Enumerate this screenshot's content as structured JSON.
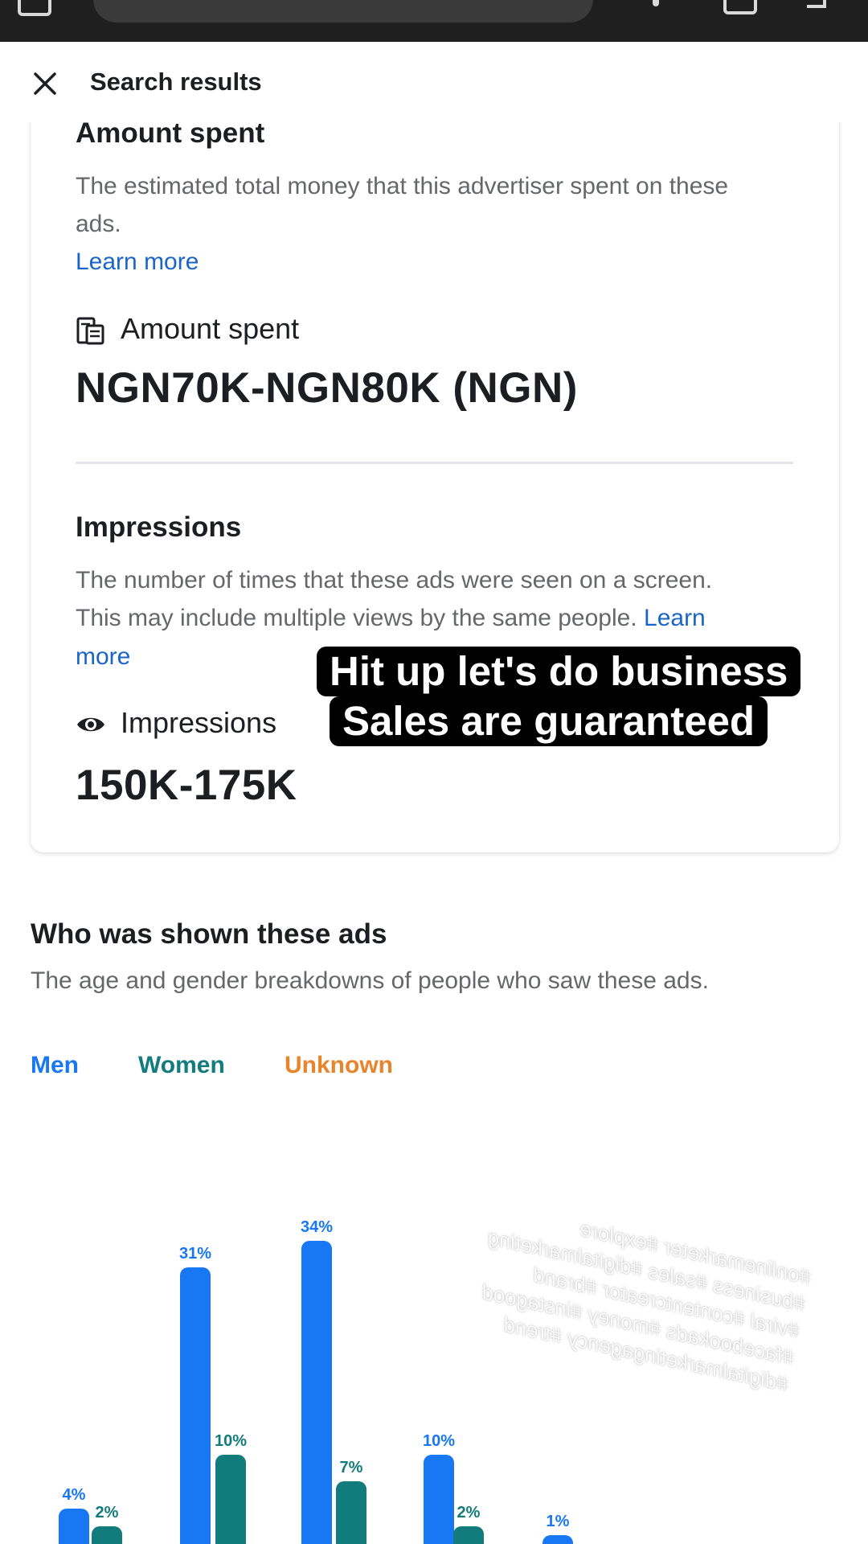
{
  "appbar": {
    "title": "Search results"
  },
  "amount_section": {
    "heading": "Amount spent",
    "description_line1": "The estimated total money that this advertiser spent on these",
    "description_line2": "ads.",
    "learn_more": "Learn more",
    "metric_label": "Amount spent",
    "metric_value": "NGN70K-NGN80K (NGN)"
  },
  "impressions_section": {
    "heading": "Impressions",
    "description_line1": "The number of times that these ads were seen on a screen.",
    "description_line2": "This may include multiple views by the same people.",
    "learn_more_part1": "Learn",
    "learn_more_part2": "more",
    "metric_label": "Impressions",
    "metric_value": "150K-175K"
  },
  "overlay": {
    "line1": "Hit up let's do business",
    "line2": "Sales are guaranteed"
  },
  "audience_section": {
    "heading": "Who was shown these ads",
    "description": "The age and gender breakdowns of people who saw these ads."
  },
  "colors": {
    "men": "#1877f2",
    "women": "#127b7b",
    "unknown": "#e8842c"
  },
  "chart_data": {
    "type": "bar",
    "legend": [
      "Men",
      "Women",
      "Unknown"
    ],
    "series": [
      {
        "name": "Men",
        "values": [
          4,
          31,
          34,
          10,
          1
        ]
      },
      {
        "name": "Women",
        "values": [
          2,
          10,
          7,
          2
        ]
      }
    ],
    "labels": {
      "men": [
        "4%",
        "31%",
        "34%",
        "10%",
        "1%"
      ],
      "women": [
        "2%",
        "10%",
        "7%",
        "2%"
      ]
    }
  },
  "watermark": {
    "line1": "#onlinemarketer #explore",
    "line2": "#business #sales #digitalmarketing",
    "line3": "#viral #contentcreator #brand",
    "line4": "#facebookads #money #instagood",
    "line5": "#digitalmarketingagency #trend"
  }
}
